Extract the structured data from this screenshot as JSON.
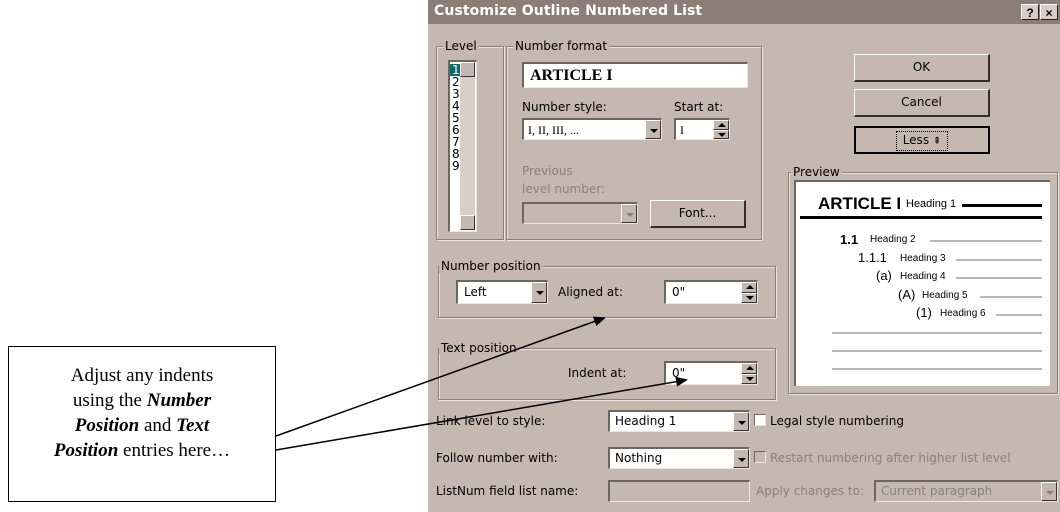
{
  "dialog": {
    "title": "Customize Outline Numbered List",
    "help_label": "?",
    "close_label": "×"
  },
  "level": {
    "title": "Level",
    "items": [
      "1",
      "2",
      "3",
      "4",
      "5",
      "6",
      "7",
      "8",
      "9"
    ],
    "selected": "1"
  },
  "number_format": {
    "title": "Number format",
    "value": "ARTICLE I",
    "number_style_label": "Number style:",
    "number_style_value": "I, II, III, ...",
    "start_at_label": "Start at:",
    "start_at_value": "I",
    "previous_label_1": "Previous",
    "previous_label_2": "level number:",
    "font_button": "Font..."
  },
  "buttons": {
    "ok": "OK",
    "cancel": "Cancel",
    "less": "Less",
    "less_arrow": "⇞"
  },
  "preview": {
    "title": "Preview",
    "lines": [
      {
        "number": "ARTICLE I",
        "heading": "Heading 1"
      },
      {
        "number": "1.1",
        "heading": "Heading 2"
      },
      {
        "number": "1.1.1",
        "heading": "Heading 3"
      },
      {
        "number": "(a)",
        "heading": "Heading 4"
      },
      {
        "number": "(A)",
        "heading": "Heading 5"
      },
      {
        "number": "(1)",
        "heading": "Heading 6"
      }
    ]
  },
  "number_position": {
    "title": "Number position",
    "alignment": "Left",
    "aligned_at_label": "Aligned at:",
    "aligned_at_value": "0\""
  },
  "text_position": {
    "title": "Text position",
    "indent_at_label": "Indent at:",
    "indent_at_value": "0\""
  },
  "bottom": {
    "link_label": "Link level to style:",
    "link_value": "Heading 1",
    "legal_label": "Legal style numbering",
    "follow_label": "Follow number with:",
    "follow_value": "Nothing",
    "restart_label": "Restart numbering after higher list level",
    "listnum_label": "ListNum field list name:",
    "apply_label": "Apply changes to:",
    "apply_value": "Current paragraph"
  },
  "callout": {
    "line1": "Adjust any indents",
    "line2_pre": "using the ",
    "line2_em": "Number",
    "line3_em1": "Position",
    "line3_mid": " and ",
    "line3_em2": "Text",
    "line4_em": "Position",
    "line4_post": " entries here…"
  },
  "colors": {
    "dialog_bg": "#c5b8b0",
    "titlebar": "#8c7e77",
    "selection": "#0b6a6a"
  }
}
